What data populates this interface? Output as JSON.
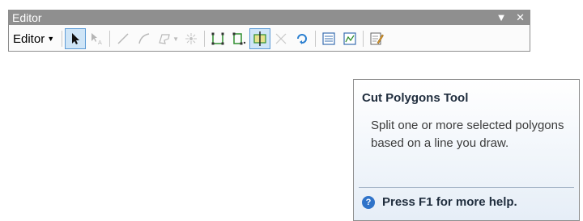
{
  "toolbar": {
    "title": "Editor",
    "menu_label": "Editor",
    "tools": [
      "edit-tool",
      "edit-annotation-tool",
      "straight-segment-tool",
      "end-point-arc-tool",
      "trace-tool",
      "point-tool",
      "edit-vertices-tool",
      "reshape-feature-tool",
      "cut-polygons-tool",
      "split-tool",
      "rotate-tool",
      "attributes-tool",
      "sketch-properties-tool",
      "create-features-tool"
    ],
    "selected_tool": "cut-polygons-tool",
    "colors": {
      "titlebar": "#8f8f8f",
      "selected": "#cfe5f7",
      "selected_border": "#5d9bd6"
    }
  },
  "tooltip": {
    "title": "Cut Polygons Tool",
    "body": "Split one or more selected polygons based on a line you draw.",
    "help": "Press F1 for more help."
  }
}
